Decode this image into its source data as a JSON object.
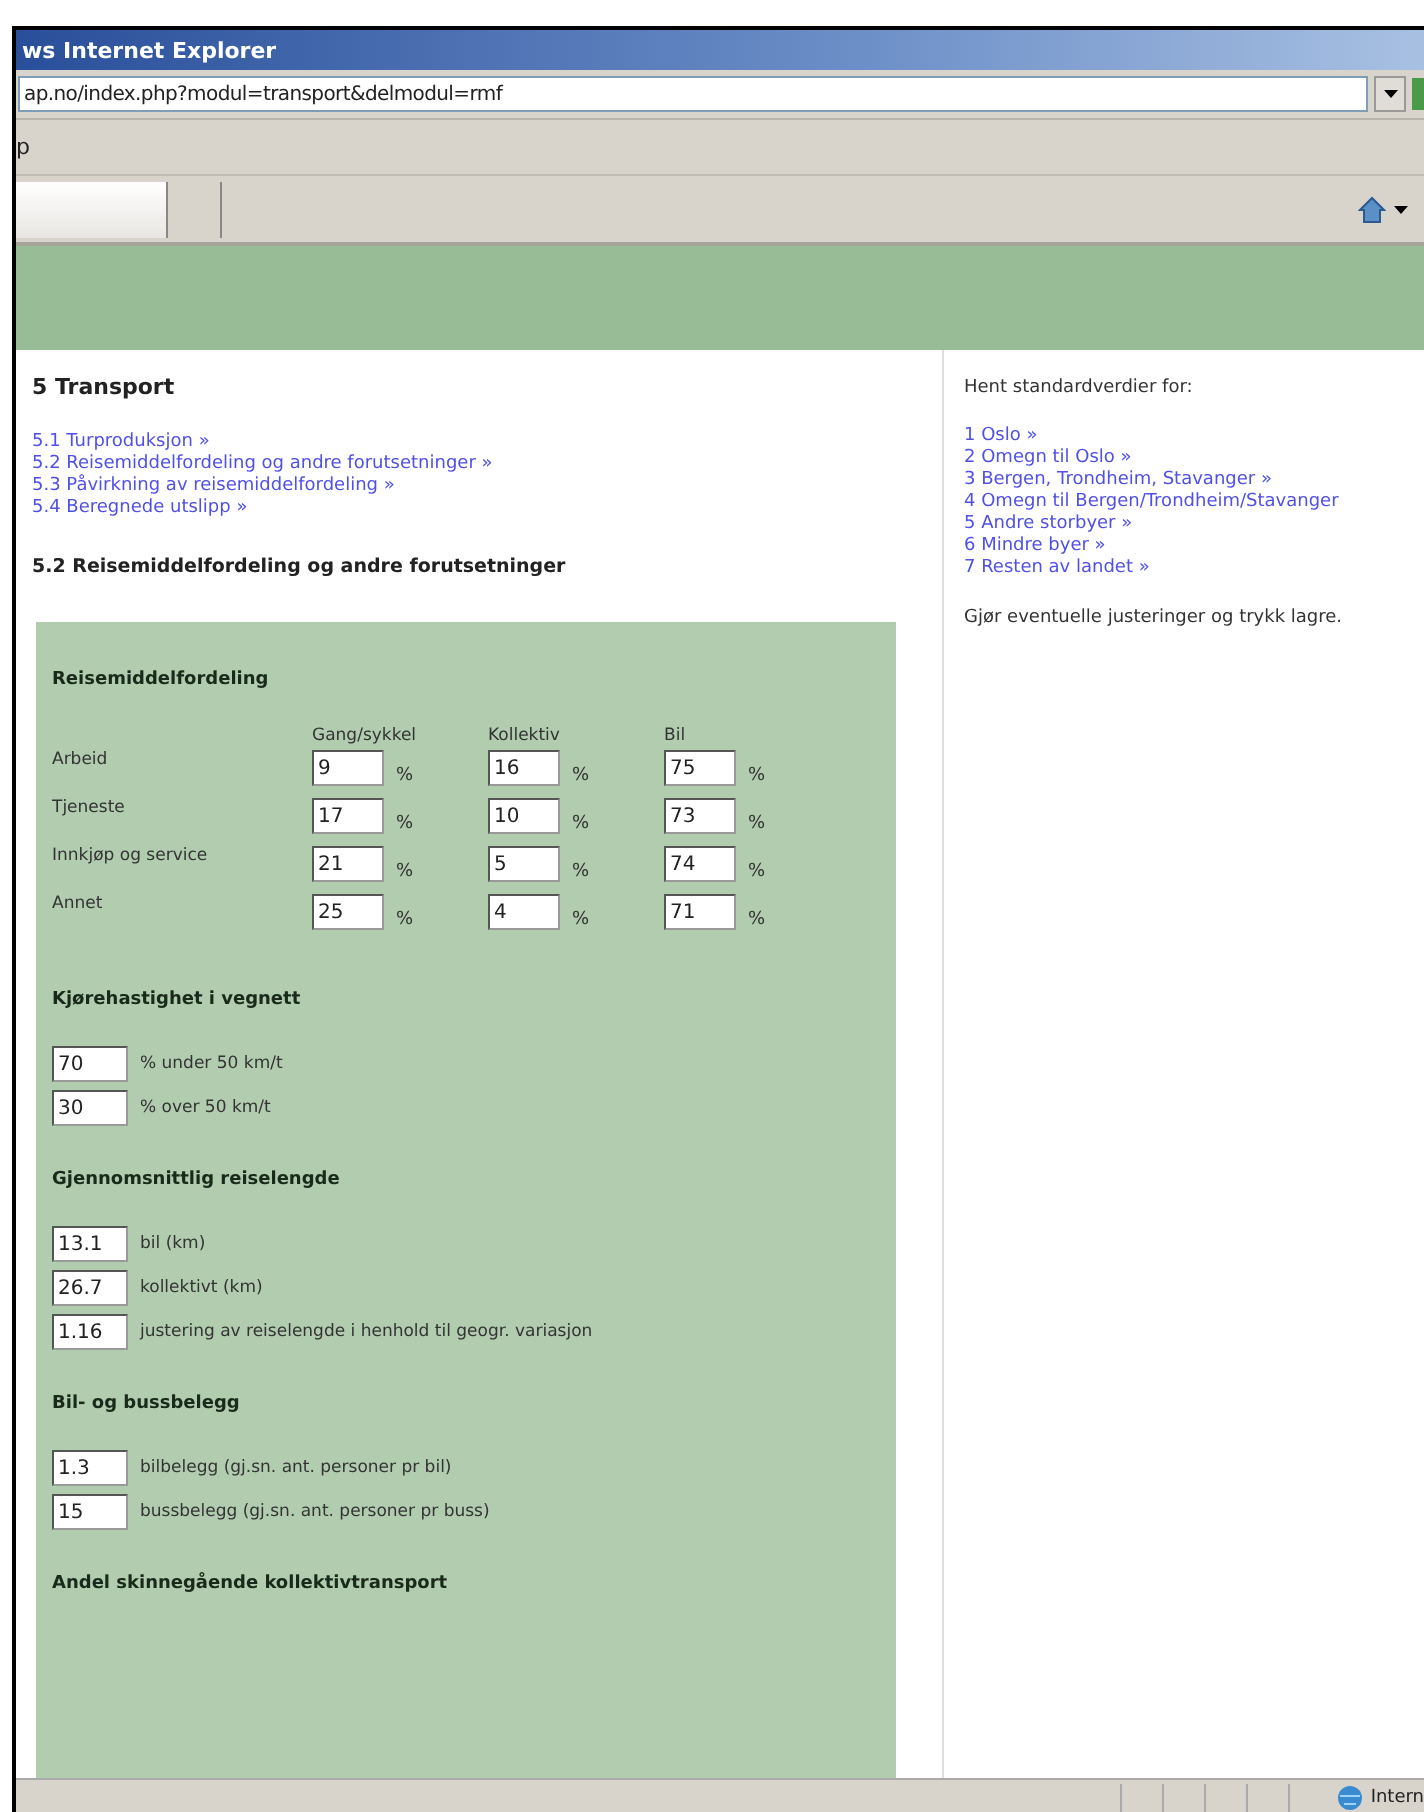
{
  "browser": {
    "title": "ws Internet Explorer",
    "address": "ap.no/index.php?modul=transport&delmodul=rmf",
    "menu": [
      "p"
    ]
  },
  "left": {
    "title": "5 Transport",
    "links": [
      "5.1 Turproduksjon »",
      "5.2 Reisemiddelfordeling og andre forutsetninger »",
      "5.3 Påvirkning av reisemiddelfordeling »",
      "5.4 Beregnede utslipp »"
    ],
    "heading": "5.2 Reisemiddelfordeling og andre forutsetninger",
    "split": {
      "title": "Reisemiddelfordeling",
      "columns": [
        "Gang/sykkel",
        "Kollektiv",
        "Bil"
      ],
      "rows": [
        {
          "label": "Arbeid",
          "cells": [
            {
              "value": "9",
              "unit": "%"
            },
            {
              "value": "16",
              "unit": "%"
            },
            {
              "value": "75",
              "unit": "%"
            }
          ]
        },
        {
          "label": "Tjeneste",
          "cells": [
            {
              "value": "17",
              "unit": "%"
            },
            {
              "value": "10",
              "unit": "%"
            },
            {
              "value": "73",
              "unit": "%"
            }
          ]
        },
        {
          "label": "Innkjøp og service",
          "cells": [
            {
              "value": "21",
              "unit": "%"
            },
            {
              "value": "5",
              "unit": "%"
            },
            {
              "value": "74",
              "unit": "%"
            }
          ]
        },
        {
          "label": "Annet",
          "cells": [
            {
              "value": "25",
              "unit": "%"
            },
            {
              "value": "4",
              "unit": "%"
            },
            {
              "value": "71",
              "unit": "%"
            }
          ]
        }
      ]
    },
    "sections": [
      {
        "title": "Kjørehastighet i vegnett",
        "fields": [
          {
            "value": "70",
            "label": "% under 50 km/t"
          },
          {
            "value": "30",
            "label": "% over 50 km/t"
          }
        ]
      },
      {
        "title": "Gjennomsnittlig reiselengde",
        "fields": [
          {
            "value": "13.1",
            "label": "bil (km)"
          },
          {
            "value": "26.7",
            "label": "kollektivt (km)"
          },
          {
            "value": "1.16",
            "label": "justering av reiselengde i henhold til geogr. variasjon"
          }
        ]
      },
      {
        "title": "Bil- og bussbelegg",
        "fields": [
          {
            "value": "1.3",
            "label": "bilbelegg (gj.sn. ant. personer pr bil)"
          },
          {
            "value": "15",
            "label": "bussbelegg (gj.sn. ant. personer pr buss)"
          }
        ]
      },
      {
        "title": "Andel skinnegående kollektivtransport"
      }
    ]
  },
  "right": {
    "intro": "Hent standardverdier for:",
    "links": [
      "1 Oslo »",
      "2 Omegn til Oslo »",
      "3 Bergen, Trondheim, Stavanger »",
      "4 Omegn til Bergen/Trondheim/Stavanger",
      "5 Andre storbyer »",
      "6 Mindre byer »",
      "7 Resten av landet »"
    ],
    "note": "Gjør eventuelle justeringer og trykk lagre."
  },
  "status_bar": {
    "zone": "Intern"
  }
}
